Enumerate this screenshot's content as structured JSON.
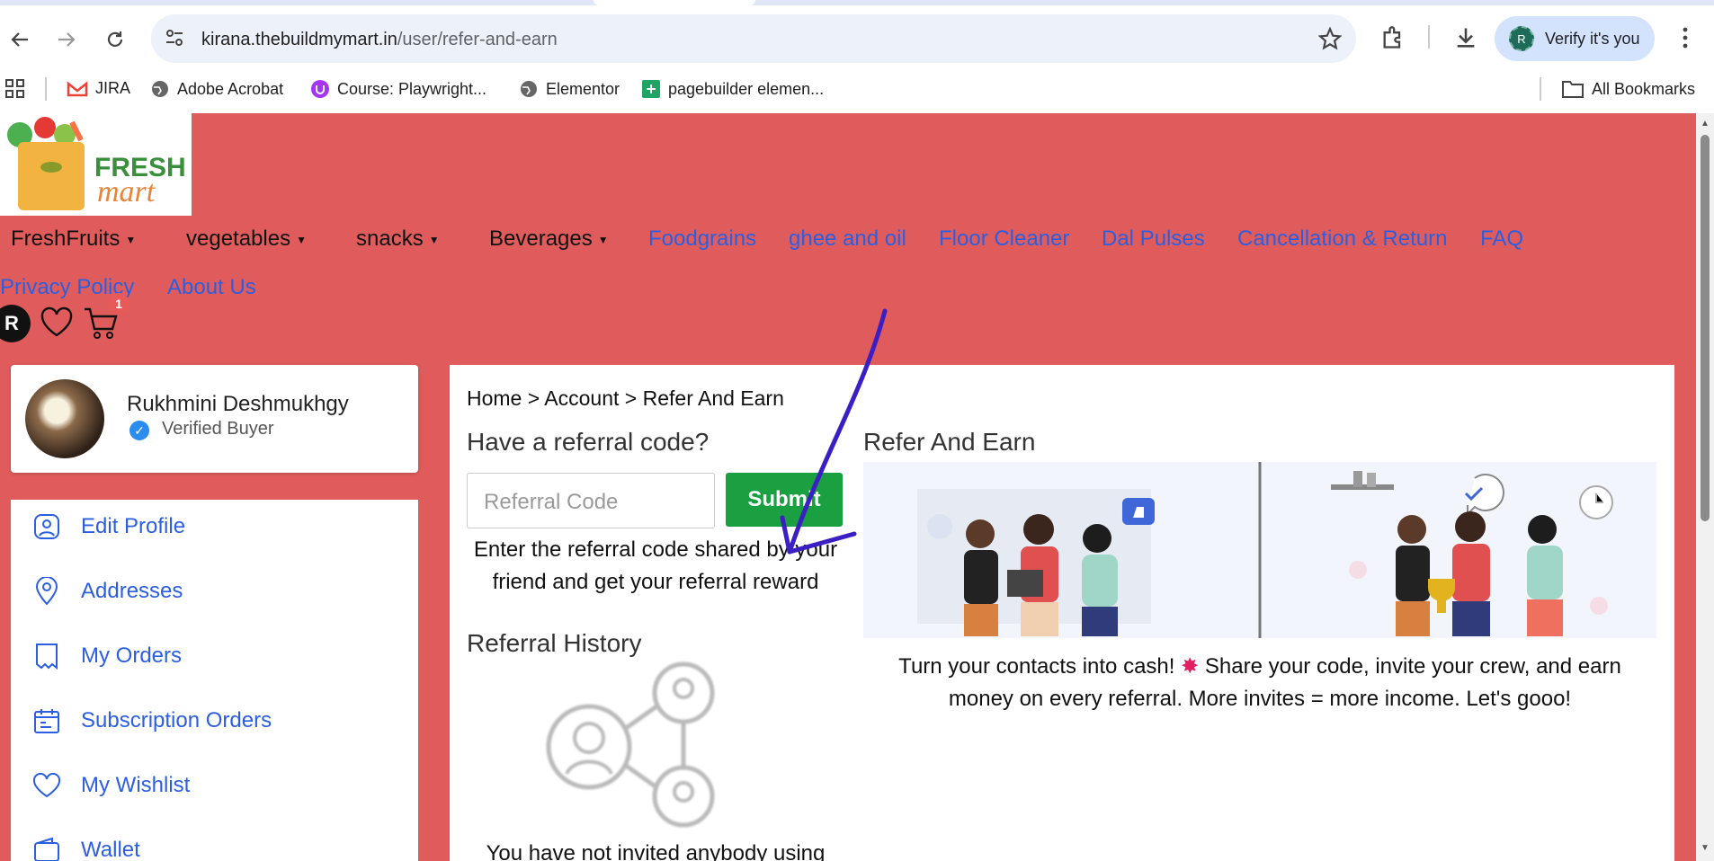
{
  "browser": {
    "url_host": "kirana.thebuildmymart.in",
    "url_path": "/user/refer-and-earn",
    "verify_label": "Verify it's you",
    "verify_initial": "R",
    "bookmarks": [
      "JIRA",
      "Adobe Acrobat",
      "Course: Playwright...",
      "Elementor",
      "pagebuilder elemen..."
    ],
    "all_bookmarks": "All Bookmarks"
  },
  "site": {
    "logo_text_1": "FRESH",
    "logo_text_2": "mart",
    "nav_dropdowns": [
      "FreshFruits",
      "vegetables",
      "snacks",
      "Beverages"
    ],
    "nav_links": [
      "Foodgrains",
      "ghee and oil",
      "Floor Cleaner",
      "Dal Pulses",
      "Cancellation & Return",
      "FAQ",
      "Privacy Policy",
      "About Us"
    ],
    "user_initial": "R",
    "cart_count": "1"
  },
  "user": {
    "name": "Rukhmini Deshmukhgy",
    "status": "Verified Buyer"
  },
  "sidebar": {
    "items": [
      "Edit Profile",
      "Addresses",
      "My Orders",
      "Subscription Orders",
      "My Wishlist",
      "Wallet"
    ]
  },
  "main": {
    "breadcrumb": "Home > Account > Refer And Earn",
    "referral_heading": "Have a referral code?",
    "referral_placeholder": "Referral Code",
    "submit_label": "Submit",
    "hint": "Enter the referral code shared by your friend and get your referral reward",
    "history_heading": "Referral History",
    "empty_text": "You have not invited anybody using",
    "refer_heading": "Refer And Earn",
    "refer_desc_1": "Turn your contacts into cash!",
    "refer_desc_2": "Share your code, invite your crew, and earn money on every referral. More invites = more income. Let's gooo!"
  },
  "colors": {
    "site_bg": "#e05c5c",
    "link": "#2b5ee0",
    "submit": "#1aa040",
    "annotation": "#3b1fc4"
  }
}
